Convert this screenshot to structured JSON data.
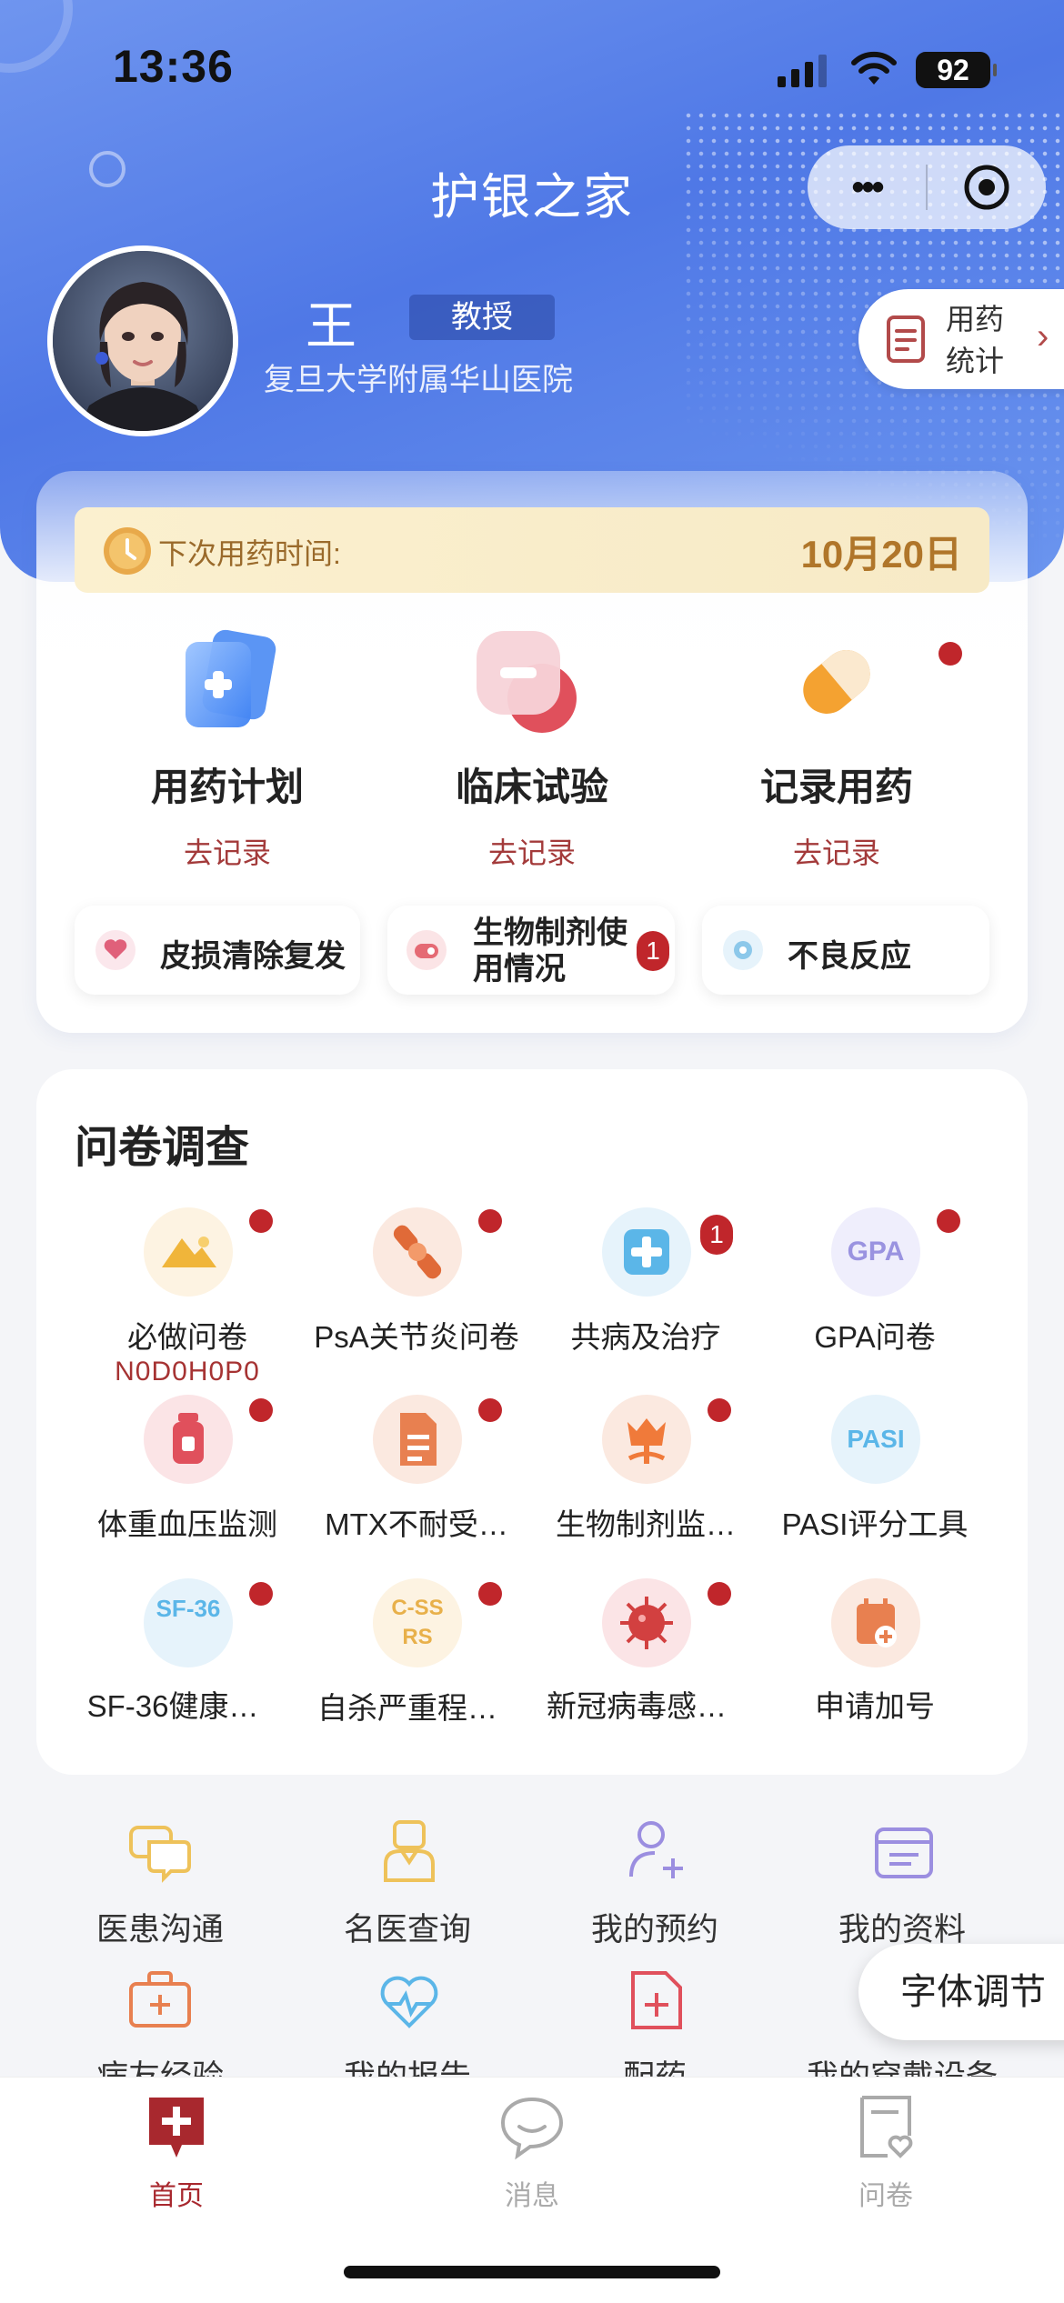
{
  "status_bar": {
    "time": "13:36",
    "battery": "92"
  },
  "app": {
    "title": "护银之家"
  },
  "profile": {
    "name": "王",
    "title": "教授",
    "hospital": "复旦大学附属华山医院",
    "stats_label": "用药统计"
  },
  "next_medication": {
    "label": "下次用药时间:",
    "date": "10月20日"
  },
  "features": [
    {
      "name": "用药计划",
      "action": "去记录",
      "icon": "medicine-card-icon"
    },
    {
      "name": "临床试验",
      "action": "去记录",
      "icon": "test-tube-icon"
    },
    {
      "name": "记录用药",
      "action": "去记录",
      "icon": "pill-capsule-icon"
    }
  ],
  "quick_pills": [
    {
      "label": "皮损清除复发",
      "icon": "heart-icon"
    },
    {
      "label": "生物制剂使用情况",
      "badge": "1",
      "icon": "biologic-icon"
    },
    {
      "label": "不良反应",
      "icon": "reaction-icon"
    }
  ],
  "survey": {
    "title": "问卷调查",
    "items": [
      {
        "label": "必做问卷",
        "code": "N0D0H0P0",
        "icon": "mountain-icon",
        "glyph": "▲"
      },
      {
        "label": "PsA关节炎问卷",
        "icon": "joint-icon",
        "glyph": "✚"
      },
      {
        "label": "共病及治疗",
        "badge": "1",
        "icon": "cross-icon",
        "glyph": "✚"
      },
      {
        "label": "GPA问卷",
        "icon": "gpa-icon",
        "glyph": "GPA"
      },
      {
        "label": "体重血压监测",
        "icon": "bottle-icon",
        "glyph": "▮"
      },
      {
        "label": "MTX不耐受…",
        "icon": "document-icon",
        "glyph": "≡"
      },
      {
        "label": "生物制剂监…",
        "icon": "tulip-icon",
        "glyph": "✿"
      },
      {
        "label": "PASI评分工具",
        "icon": "pasi-icon",
        "glyph": "PASI"
      },
      {
        "label": "SF-36健康…",
        "icon": "sf36-icon",
        "glyph": "SF-36"
      },
      {
        "label": "自杀严重程…",
        "icon": "cssrs-icon",
        "glyph": "C-SSRS"
      },
      {
        "label": "新冠病毒感…",
        "icon": "virus-icon",
        "glyph": "✹"
      },
      {
        "label": "申请加号",
        "icon": "calendar-add-icon",
        "glyph": "+"
      }
    ]
  },
  "tools": [
    {
      "label": "医患沟通",
      "icon": "chat-bubbles-icon"
    },
    {
      "label": "名医查询",
      "icon": "doctor-icon"
    },
    {
      "label": "我的预约",
      "icon": "user-add-icon"
    },
    {
      "label": "我的资料",
      "icon": "folder-icon"
    },
    {
      "label": "病友经验",
      "icon": "medical-kit-icon"
    },
    {
      "label": "我的报告",
      "icon": "heartbeat-icon"
    },
    {
      "label": "配药",
      "icon": "prescription-icon"
    },
    {
      "label": "我的穿戴设备",
      "icon": "wearable-icon"
    }
  ],
  "font_adjust": {
    "label": "字体调节"
  },
  "tabbar": [
    {
      "label": "首页",
      "icon": "home-cross-icon",
      "active": true
    },
    {
      "label": "消息",
      "icon": "message-icon",
      "active": false
    },
    {
      "label": "问卷",
      "icon": "survey-icon",
      "active": false
    }
  ],
  "colors": {
    "primary_blue": "#4f78e6",
    "accent_red": "#a8282e",
    "badge_red": "#c0262b",
    "gold": "#b0762a"
  }
}
